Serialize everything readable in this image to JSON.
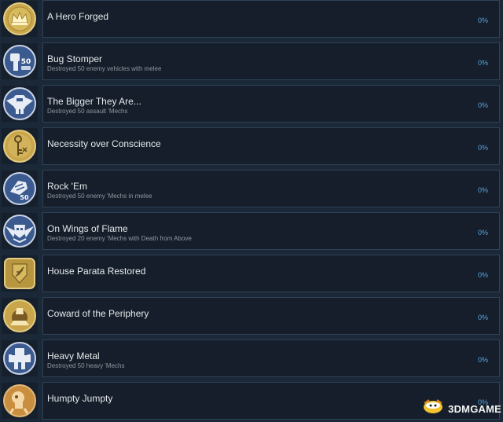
{
  "achievements": [
    {
      "title": "A Hero Forged",
      "desc": "",
      "percent": "0%",
      "icon": "crown-icon"
    },
    {
      "title": "Bug Stomper",
      "desc": "Destroyed 50 enemy vehicles with melee",
      "percent": "0%",
      "icon": "mech-fist-50-icon"
    },
    {
      "title": "The Bigger They Are...",
      "desc": "Destroyed 50 assault 'Mechs",
      "percent": "0%",
      "icon": "assault-mech-wings-icon"
    },
    {
      "title": "Necessity over Conscience",
      "desc": "",
      "percent": "0%",
      "icon": "key-icon"
    },
    {
      "title": "Rock 'Em",
      "desc": "Destroyed 50 enemy 'Mechs in melee",
      "percent": "0%",
      "icon": "fist-50-icon"
    },
    {
      "title": "On Wings of Flame",
      "desc": "Destroyed 20 enemy 'Mechs with Death from Above",
      "percent": "0%",
      "icon": "winged-skull-icon"
    },
    {
      "title": "House Parata Restored",
      "desc": "",
      "percent": "0%",
      "icon": "house-crest-icon"
    },
    {
      "title": "Coward of the Periphery",
      "desc": "",
      "percent": "0%",
      "icon": "periphery-emblem-icon"
    },
    {
      "title": "Heavy Metal",
      "desc": "Destroyed 50 heavy 'Mechs",
      "percent": "0%",
      "icon": "heavy-mech-icon"
    },
    {
      "title": "Humpty Jumpty",
      "desc": "",
      "percent": "0%",
      "icon": "jumping-mech-icon"
    }
  ],
  "watermark": {
    "text": "3DMGAME"
  },
  "colors": {
    "background": "#1b2838",
    "card": "#151e2a",
    "border": "#2e4258",
    "percent": "#5ba3dd",
    "gold": "#c9a64b",
    "blue": "#3b5a8f"
  }
}
